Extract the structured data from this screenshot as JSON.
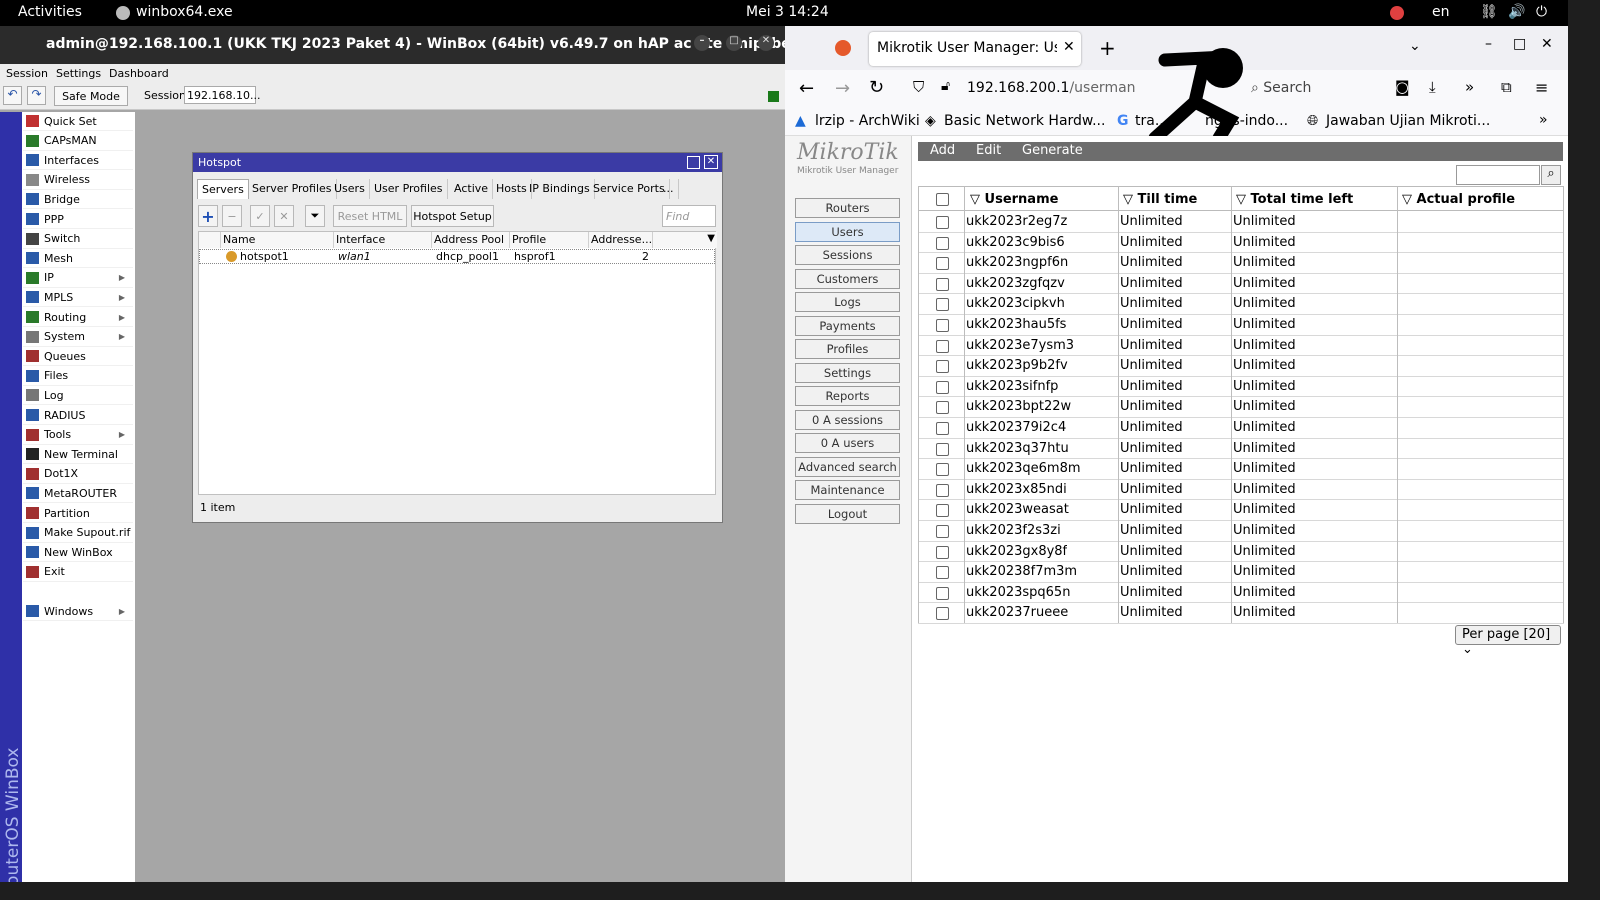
{
  "topbar": {
    "activities": "Activities",
    "app": "winbox64.exe",
    "clock": "Mei 3  14:24",
    "lang": "en"
  },
  "winbox": {
    "title": "admin@192.168.100.1 (UKK TKJ 2023 Paket 4) - WinBox (64bit) v6.49.7 on hAP ac lite (mipsbe)",
    "menu": [
      "Session",
      "Settings",
      "Dashboard"
    ],
    "safe_mode": "Safe Mode",
    "session_label": "Session:",
    "session_value": "192.168.10...",
    "vertical_brand": "RouterOS WinBox",
    "sidebar": [
      "Quick Set",
      "CAPsMAN",
      "Interfaces",
      "Wireless",
      "Bridge",
      "PPP",
      "Switch",
      "Mesh",
      "IP",
      "MPLS",
      "Routing",
      "System",
      "Queues",
      "Files",
      "Log",
      "RADIUS",
      "Tools",
      "New Terminal",
      "Dot1X",
      "MetaROUTER",
      "Partition",
      "Make Supout.rif",
      "New WinBox",
      "Exit",
      "Windows"
    ],
    "hotspot": {
      "title": "Hotspot",
      "tabs": [
        "Servers",
        "Server Profiles",
        "Users",
        "User Profiles",
        "Active",
        "Hosts",
        "IP Bindings",
        "Service Ports",
        "..."
      ],
      "reset_html": "Reset HTML",
      "setup": "Hotspot Setup",
      "find_placeholder": "Find",
      "columns": [
        "Name",
        "Interface",
        "Address Pool",
        "Profile",
        "Addresse..."
      ],
      "row": {
        "name": "hotspot1",
        "interface": "wlan1",
        "pool": "dhcp_pool1",
        "profile": "hsprof1",
        "addresses": "2"
      },
      "status": "1 item"
    }
  },
  "firefox": {
    "tab_title": "Mikrotik User Manager: User",
    "url_host": "192.168.200.1",
    "url_path": "/userman",
    "search": "Search",
    "bookmarks": [
      "lrzip - ArchWiki",
      "Basic Network Hardw...",
      "tra...",
      "ngris-indo...",
      "Jawaban Ujian Mikroti..."
    ]
  },
  "userman": {
    "logo": "MikroTik",
    "logo_sub": "Mikrotik User Manager",
    "toolbar": [
      "Add",
      "Edit",
      "Generate"
    ],
    "menu": [
      "Routers",
      "Users",
      "Sessions",
      "Customers",
      "Logs",
      "Payments",
      "Profiles",
      "Settings",
      "Reports",
      "0 A sessions",
      "0 A users",
      "Advanced search",
      "Maintenance",
      "Logout"
    ],
    "columns": [
      "Username",
      "Till time",
      "Total time left",
      "Actual profile"
    ],
    "users": [
      "ukk2023r2eg7z",
      "ukk2023c9bis6",
      "ukk2023ngpf6n",
      "ukk2023zgfqzv",
      "ukk2023cipkvh",
      "ukk2023hau5fs",
      "ukk2023e7ysm3",
      "ukk2023p9b2fv",
      "ukk2023sifnfp",
      "ukk2023bpt22w",
      "ukk202379i2c4",
      "ukk2023q37htu",
      "ukk2023qe6m8m",
      "ukk2023x85ndi",
      "ukk2023weasat",
      "ukk2023f2s3zi",
      "ukk2023gx8y8f",
      "ukk20238f7m3m",
      "ukk2023spq65n",
      "ukk20237rueee"
    ],
    "unlimited": "Unlimited",
    "per_page": "Per page [20]"
  }
}
